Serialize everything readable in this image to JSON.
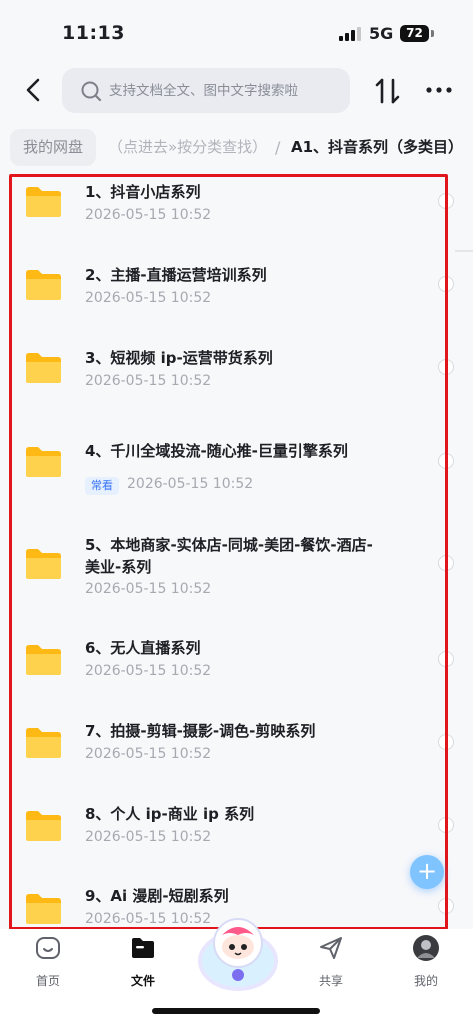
{
  "status_bar": {
    "time": "11:13",
    "network": "5G",
    "battery": "72"
  },
  "search": {
    "placeholder": "支持文档全文、图中文字搜索啦"
  },
  "breadcrumb": {
    "root": "我的网盘",
    "middle": "（点进去»按分类查找）",
    "separator": "/",
    "current": "A1、抖音系列（多类目）"
  },
  "files": [
    {
      "name": "1、抖音小店系列",
      "date": "2026-05-15 10:52"
    },
    {
      "name": "2、主播-直播运营培训系列",
      "date": "2026-05-15 10:52"
    },
    {
      "name": "3、短视频 ip-运营带货系列",
      "date": "2026-05-15 10:52"
    },
    {
      "name": "4、千川全域投流-随心推-巨量引擎系列",
      "date": "2026-05-15 10:52",
      "tag": "常看"
    },
    {
      "name": "5、本地商家-实体店-同城-美团-餐饮-酒店-美业-系列",
      "date": "2026-05-15 10:52"
    },
    {
      "name": "6、无人直播系列",
      "date": "2026-05-15 10:52"
    },
    {
      "name": "7、拍摄-剪辑-摄影-调色-剪映系列",
      "date": "2026-05-15 10:52"
    },
    {
      "name": "8、个人 ip-商业 ip 系列",
      "date": "2026-05-15 10:52"
    },
    {
      "name": "9、Ai 漫剧-短剧系列",
      "date": "2026-05-15 10:52"
    }
  ],
  "fab": {
    "label": "+"
  },
  "tabbar": {
    "items": [
      {
        "label": "首页",
        "icon": "home-icon"
      },
      {
        "label": "文件",
        "icon": "folder-icon",
        "active": true
      },
      {
        "label": "共享",
        "icon": "share-plane-icon"
      },
      {
        "label": "我的",
        "icon": "avatar-icon"
      }
    ]
  },
  "colors": {
    "accent": "#3773f5",
    "highlight_frame": "#e0161c",
    "folder": "#ffc93a"
  }
}
